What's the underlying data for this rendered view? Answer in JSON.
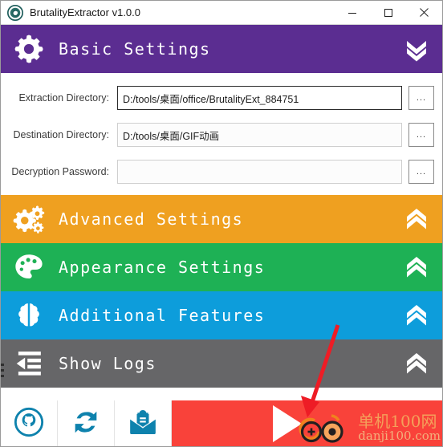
{
  "window": {
    "title": "BrutalityExtractor v1.0.0",
    "icon": "app-logo-icon",
    "controls": {
      "minimize": "minimize-icon",
      "maximize": "maximize-icon",
      "close": "close-icon"
    }
  },
  "sections": [
    {
      "id": "basic",
      "title": "Basic Settings",
      "icon": "gear-icon",
      "chevron": "chevron-double-down-icon",
      "color": "#5B2D91",
      "expanded": true
    },
    {
      "id": "advanced",
      "title": "Advanced Settings",
      "icon": "gears-icon",
      "chevron": "chevron-double-up-icon",
      "color": "#EFA020",
      "expanded": false
    },
    {
      "id": "appearance",
      "title": "Appearance Settings",
      "icon": "palette-icon",
      "chevron": "chevron-double-up-icon",
      "color": "#1EB155",
      "expanded": false
    },
    {
      "id": "additional",
      "title": "Additional Features",
      "icon": "brain-icon",
      "chevron": "chevron-double-up-icon",
      "color": "#0D9DDB",
      "expanded": false
    },
    {
      "id": "logs",
      "title": "Show Logs",
      "icon": "indent-list-icon",
      "chevron": "chevron-double-up-icon",
      "color": "#666668",
      "expanded": false
    }
  ],
  "basic_settings": {
    "fields": [
      {
        "label": "Extraction Directory:",
        "value": "D:/tools/桌面/office/BrutalityExt_884751",
        "placeholder": "",
        "browse_label": "...",
        "focused": true
      },
      {
        "label": "Destination Directory:",
        "value": "D:/tools/桌面/GIF动画",
        "placeholder": "",
        "browse_label": "...",
        "focused": false
      },
      {
        "label": "Decryption Password:",
        "value": "",
        "placeholder": "",
        "browse_label": "...",
        "focused": false
      }
    ]
  },
  "toolbar": {
    "buttons": [
      {
        "name": "github-icon",
        "color": "#0E82AD"
      },
      {
        "name": "refresh-sync-icon",
        "color": "#0E82AD"
      },
      {
        "name": "mail-document-icon",
        "color": "#0E82AD"
      }
    ],
    "start": {
      "name": "play-icon",
      "color": "#F9423A"
    }
  },
  "watermark": {
    "cn": "单机100网",
    "en": "danji100.com",
    "logo": "danji-circles-icon"
  },
  "annotation": {
    "arrow": "red-pointer-arrow"
  },
  "colors": {
    "purple": "#5B2D91",
    "orange": "#EFA020",
    "green": "#1EB155",
    "blue": "#0D9DDB",
    "gray": "#666668",
    "red": "#F9423A",
    "teal": "#0E82AD"
  }
}
